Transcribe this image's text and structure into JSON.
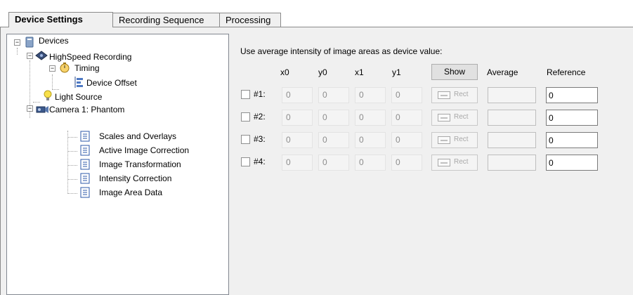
{
  "tabs": [
    {
      "label": "Device Settings",
      "active": true
    },
    {
      "label": "Recording Sequence",
      "active": false
    },
    {
      "label": "Processing",
      "active": false
    }
  ],
  "tree": {
    "devices": "Devices",
    "highspeed": "HighSpeed Recording",
    "timing": "Timing",
    "device_offset": "Device Offset",
    "light_source": "Light Source",
    "camera": "Camera 1: Phantom",
    "scales": "Scales and Overlays",
    "active_image": "Active Image Correction",
    "image_transform": "Image Transformation",
    "intensity": "Intensity Correction",
    "image_area": "Image Area Data"
  },
  "panel": {
    "heading": "Use average intensity of image areas as device value:",
    "columns": {
      "x0": "x0",
      "y0": "y0",
      "x1": "x1",
      "y1": "y1",
      "average": "Average",
      "reference": "Reference"
    },
    "show_label": "Show",
    "rect_label": "Rect",
    "rows": [
      {
        "label": "#1:",
        "x0": "0",
        "y0": "0",
        "x1": "0",
        "y1": "0",
        "reference": "0"
      },
      {
        "label": "#2:",
        "x0": "0",
        "y0": "0",
        "x1": "0",
        "y1": "0",
        "reference": "0"
      },
      {
        "label": "#3:",
        "x0": "0",
        "y0": "0",
        "x1": "0",
        "y1": "0",
        "reference": "0"
      },
      {
        "label": "#4:",
        "x0": "0",
        "y0": "0",
        "x1": "0",
        "y1": "0",
        "reference": "0"
      }
    ]
  }
}
